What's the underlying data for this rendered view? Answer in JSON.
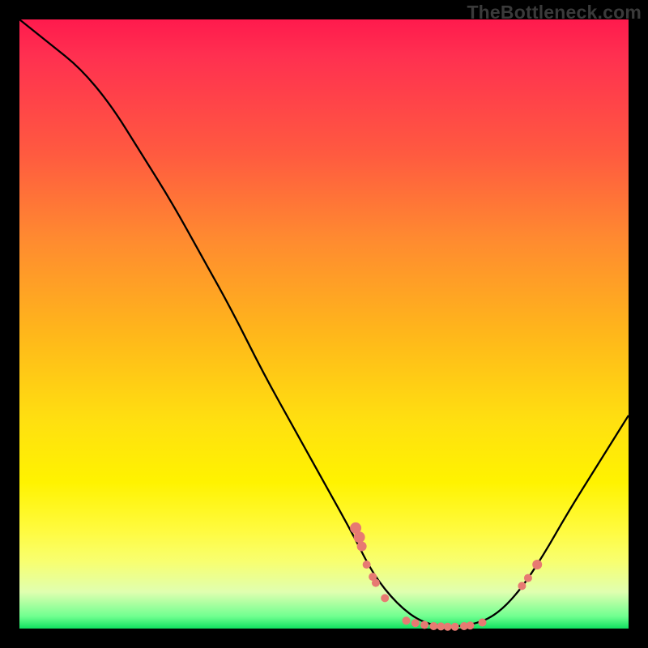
{
  "watermark": "TheBottleneck.com",
  "chart_data": {
    "type": "line",
    "title": "",
    "xlabel": "",
    "ylabel": "",
    "xlim": [
      0,
      100
    ],
    "ylim": [
      0,
      100
    ],
    "curve": [
      {
        "x": 0,
        "y": 100
      },
      {
        "x": 5,
        "y": 96
      },
      {
        "x": 10,
        "y": 92
      },
      {
        "x": 15,
        "y": 86
      },
      {
        "x": 20,
        "y": 78
      },
      {
        "x": 25,
        "y": 70
      },
      {
        "x": 30,
        "y": 61
      },
      {
        "x": 35,
        "y": 52
      },
      {
        "x": 40,
        "y": 42
      },
      {
        "x": 45,
        "y": 33
      },
      {
        "x": 50,
        "y": 24
      },
      {
        "x": 55,
        "y": 15
      },
      {
        "x": 58,
        "y": 9
      },
      {
        "x": 62,
        "y": 4
      },
      {
        "x": 66,
        "y": 1
      },
      {
        "x": 70,
        "y": 0.3
      },
      {
        "x": 74,
        "y": 0.5
      },
      {
        "x": 78,
        "y": 2
      },
      {
        "x": 82,
        "y": 6
      },
      {
        "x": 86,
        "y": 12
      },
      {
        "x": 90,
        "y": 19
      },
      {
        "x": 95,
        "y": 27
      },
      {
        "x": 100,
        "y": 35
      }
    ],
    "dots": [
      {
        "x": 55.2,
        "y": 16.5,
        "r": 7
      },
      {
        "x": 55.8,
        "y": 15,
        "r": 7
      },
      {
        "x": 56.2,
        "y": 13.5,
        "r": 6
      },
      {
        "x": 57,
        "y": 10.5,
        "r": 5
      },
      {
        "x": 58,
        "y": 8.5,
        "r": 5
      },
      {
        "x": 58.5,
        "y": 7.5,
        "r": 5
      },
      {
        "x": 60,
        "y": 5,
        "r": 5
      },
      {
        "x": 63.5,
        "y": 1.3,
        "r": 5
      },
      {
        "x": 65,
        "y": 0.9,
        "r": 5
      },
      {
        "x": 66.5,
        "y": 0.6,
        "r": 5
      },
      {
        "x": 68,
        "y": 0.4,
        "r": 5
      },
      {
        "x": 69.2,
        "y": 0.35,
        "r": 5
      },
      {
        "x": 70.3,
        "y": 0.3,
        "r": 5
      },
      {
        "x": 71.5,
        "y": 0.3,
        "r": 5
      },
      {
        "x": 73,
        "y": 0.4,
        "r": 5
      },
      {
        "x": 74,
        "y": 0.5,
        "r": 5
      },
      {
        "x": 76,
        "y": 1,
        "r": 5
      },
      {
        "x": 82.5,
        "y": 7,
        "r": 5
      },
      {
        "x": 83.5,
        "y": 8.3,
        "r": 5
      },
      {
        "x": 85,
        "y": 10.5,
        "r": 6
      }
    ]
  }
}
